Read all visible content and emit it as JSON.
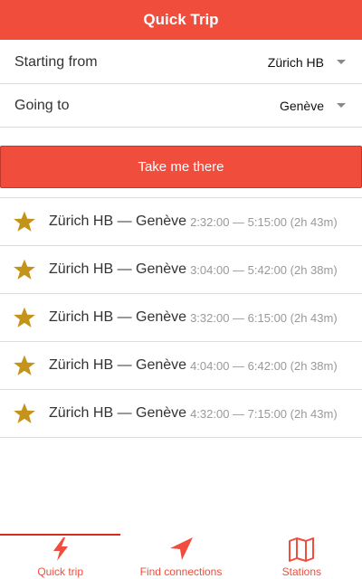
{
  "header": {
    "title": "Quick Trip"
  },
  "from": {
    "label": "Starting from",
    "value": "Zürich HB"
  },
  "to": {
    "label": "Going to",
    "value": "Genève"
  },
  "cta": {
    "label": "Take me there"
  },
  "trips": [
    {
      "route": "Zürich HB — Genève",
      "times": "2:32:00 — 5:15:00 (2h 43m)"
    },
    {
      "route": "Zürich HB — Genève",
      "times": "3:04:00 — 5:42:00 (2h 38m)"
    },
    {
      "route": "Zürich HB — Genève",
      "times": "3:32:00 — 6:15:00 (2h 43m)"
    },
    {
      "route": "Zürich HB — Genève",
      "times": "4:04:00 — 6:42:00 (2h 38m)"
    },
    {
      "route": "Zürich HB — Genève",
      "times": "4:32:00 — 7:15:00 (2h 43m)"
    }
  ],
  "tabs": [
    {
      "label": "Quick trip",
      "icon": "lightning-icon",
      "active": true
    },
    {
      "label": "Find connections",
      "icon": "navigation-arrow-icon",
      "active": false
    },
    {
      "label": "Stations",
      "icon": "map-icon",
      "active": false
    }
  ],
  "colors": {
    "accent": "#f04d3d",
    "star": "#c4941a",
    "divider": "#dcdcdc",
    "muted": "#999999"
  }
}
